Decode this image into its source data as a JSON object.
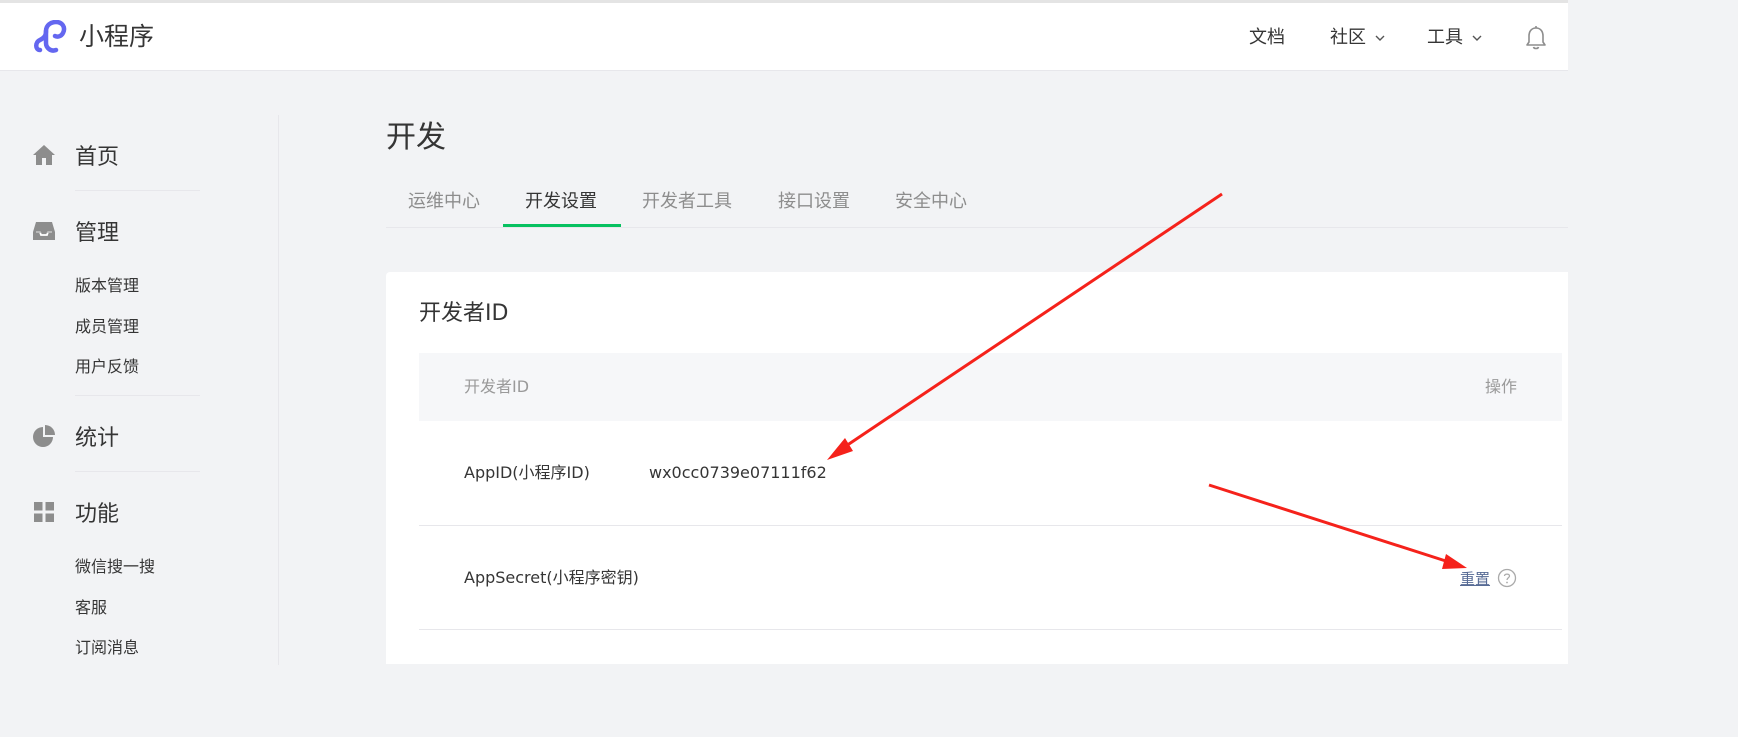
{
  "header": {
    "brand": "小程序",
    "nav": {
      "docs": "文档",
      "community": "社区",
      "tools": "工具"
    },
    "icons": {
      "logo": "mini-program-logo",
      "bell": "bell-icon",
      "chevron": "chevron-down-icon"
    }
  },
  "sidebar": {
    "home": {
      "label": "首页",
      "icon": "home-icon"
    },
    "manage": {
      "label": "管理",
      "icon": "inbox-icon",
      "items": [
        "版本管理",
        "成员管理",
        "用户反馈"
      ]
    },
    "stats": {
      "label": "统计",
      "icon": "pie-chart-icon"
    },
    "features": {
      "label": "功能",
      "icon": "grid-icon",
      "items": [
        "微信搜一搜",
        "客服",
        "订阅消息"
      ]
    }
  },
  "main": {
    "title": "开发",
    "tabs": [
      "运维中心",
      "开发设置",
      "开发者工具",
      "接口设置",
      "安全中心"
    ],
    "active_tab": "开发设置",
    "card": {
      "title": "开发者ID",
      "columns": {
        "left": "开发者ID",
        "right": "操作"
      },
      "rows": [
        {
          "label": "AppID(小程序ID)",
          "value": "wx0cc0739e07111f62"
        },
        {
          "label": "AppSecret(小程序密钥)",
          "action": "重置"
        }
      ]
    }
  },
  "colors": {
    "accent_green": "#07c160",
    "link_blue": "#576b95",
    "annotation_red": "#f5221b",
    "icon_gray": "#8d8d8d",
    "logo_purple": "#6467f0"
  }
}
